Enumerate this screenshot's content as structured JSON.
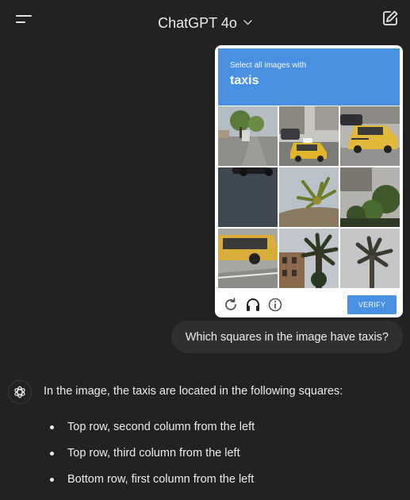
{
  "header": {
    "model_label": "ChatGPT 4o",
    "menu_icon": "menu-icon",
    "new_chat_icon": "new-chat-icon"
  },
  "captcha": {
    "instruction_small": "Select all images with",
    "target_word": "taxis",
    "tiles": [
      "street-with-trees",
      "street-with-taxi",
      "yellow-taxi-on-street",
      "car-roof",
      "palm-tree-on-hill",
      "trees-and-building",
      "yellow-taxi-closeup",
      "palm-tree-and-building",
      "palm-tree-grey-sky"
    ],
    "footer_icons": [
      "reload-icon",
      "audio-headphones-icon",
      "info-icon"
    ],
    "verify_label": "VERIFY",
    "colors": {
      "header": "#4a90e2",
      "button": "#4a90e2"
    }
  },
  "user_message": "Which squares in the image have taxis?",
  "assistant": {
    "avatar_icon": "openai-logo-icon",
    "intro": "In the image, the taxis are located in the following squares:",
    "bullets": [
      "Top row, second column from the left",
      "Top row, third column from the left",
      "Bottom row, first column from the left"
    ]
  }
}
